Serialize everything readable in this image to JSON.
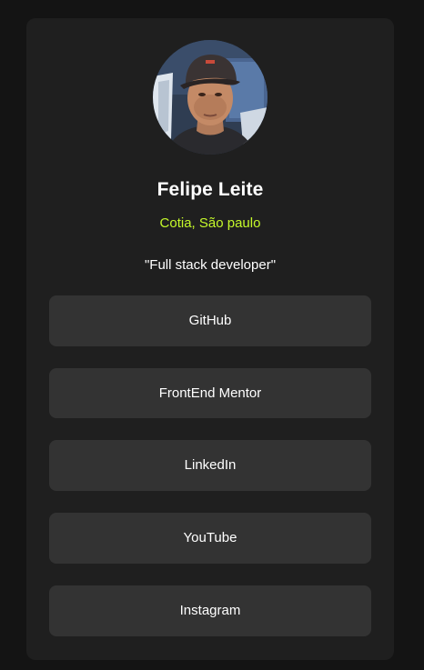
{
  "profile": {
    "name": "Felipe Leite",
    "location": "Cotia, São paulo",
    "bio": "\"Full stack developer\""
  },
  "links": [
    {
      "label": "GitHub"
    },
    {
      "label": "FrontEnd Mentor"
    },
    {
      "label": "LinkedIn"
    },
    {
      "label": "YouTube"
    },
    {
      "label": "Instagram"
    }
  ],
  "colors": {
    "page_background": "#141414",
    "card_background": "#1f1f1f",
    "button_background": "#333333",
    "accent": "#c4f82a",
    "text": "#ffffff"
  }
}
